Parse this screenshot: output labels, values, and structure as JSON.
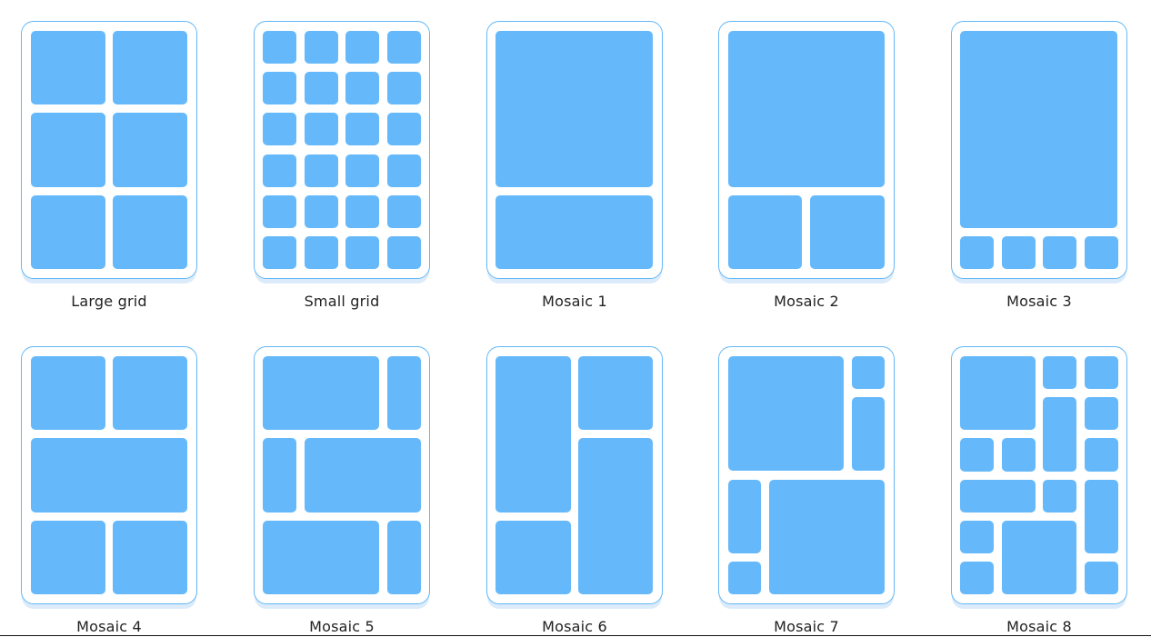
{
  "colors": {
    "tile": "#65b9fb",
    "frame_border": "#62b8f7",
    "frame_shadow": "#dcebfa",
    "label": "#222222"
  },
  "layouts": [
    {
      "id": "large-grid",
      "label": "Large grid"
    },
    {
      "id": "small-grid",
      "label": "Small grid"
    },
    {
      "id": "mosaic-1",
      "label": "Mosaic 1"
    },
    {
      "id": "mosaic-2",
      "label": "Mosaic 2"
    },
    {
      "id": "mosaic-3",
      "label": "Mosaic 3"
    },
    {
      "id": "mosaic-4",
      "label": "Mosaic 4"
    },
    {
      "id": "mosaic-5",
      "label": "Mosaic 5"
    },
    {
      "id": "mosaic-6",
      "label": "Mosaic 6"
    },
    {
      "id": "mosaic-7",
      "label": "Mosaic 7"
    },
    {
      "id": "mosaic-8",
      "label": "Mosaic 8"
    }
  ]
}
